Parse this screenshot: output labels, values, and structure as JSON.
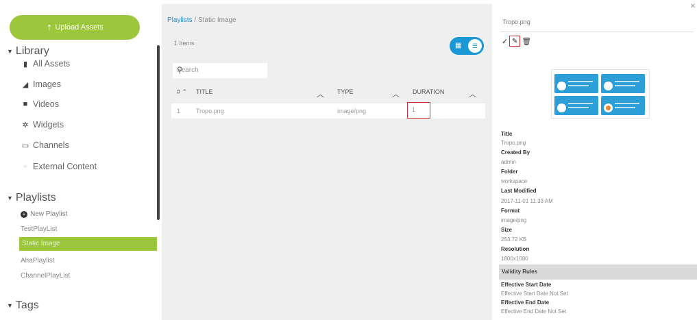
{
  "sidebar": {
    "upload_label": "Upload Assets",
    "library_label": "Library",
    "library_items": [
      {
        "label": "All Assets",
        "icon": "file-icon"
      },
      {
        "label": "Images",
        "icon": "image-icon"
      },
      {
        "label": "Videos",
        "icon": "video-icon"
      },
      {
        "label": "Widgets",
        "icon": "gear-icon"
      },
      {
        "label": "Channels",
        "icon": "monitor-icon"
      },
      {
        "label": "External Content",
        "icon": "external-icon"
      }
    ],
    "playlists_label": "Playlists",
    "new_playlist_label": "New Playlist",
    "playlists": [
      "TestPlayList",
      "Static Image",
      "AhaPlaylist",
      "ChannelPlayList"
    ],
    "selected_playlist": "Static Image",
    "tags_label": "Tags"
  },
  "main": {
    "breadcrumb_root": "Playlists",
    "breadcrumb_sep": "/",
    "breadcrumb_current": "Static Image",
    "items_count": "1 Items",
    "search_placeholder": "Search",
    "columns": {
      "num": "#",
      "title": "TITLE",
      "type": "TYPE",
      "duration": "DURATION"
    },
    "rows": [
      {
        "num": "1",
        "title": "Tropo.png",
        "type": "image/png",
        "duration": "1"
      }
    ]
  },
  "panel": {
    "file_title": "Tropo.png",
    "fields": [
      {
        "label": "Title",
        "value": "Tropo.png"
      },
      {
        "label": "Created By",
        "value": "admin"
      },
      {
        "label": "Folder",
        "value": "workspace"
      },
      {
        "label": "Last Modified",
        "value": "2017-11-01 11:33 AM"
      },
      {
        "label": "Format",
        "value": "image/png"
      },
      {
        "label": "Size",
        "value": "253.72 KB"
      },
      {
        "label": "Resolution",
        "value": "1800x1080"
      }
    ],
    "validity_label": "Validity Rules",
    "validity_fields": [
      {
        "label": "Effective Start Date",
        "value": "Effective Start Date Not Set"
      },
      {
        "label": "Effective End Date",
        "value": "Effective End Date Not Set"
      }
    ]
  },
  "colors": {
    "accent_green": "#9cc63b",
    "accent_blue": "#1998d5",
    "highlight_red": "#d32f2f"
  }
}
